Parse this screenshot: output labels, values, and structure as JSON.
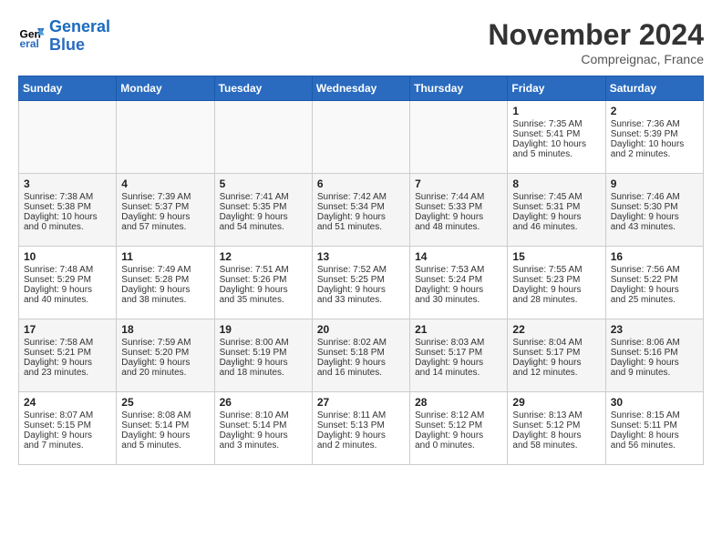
{
  "header": {
    "logo_line1": "General",
    "logo_line2": "Blue",
    "month": "November 2024",
    "location": "Compreignac, France"
  },
  "weekdays": [
    "Sunday",
    "Monday",
    "Tuesday",
    "Wednesday",
    "Thursday",
    "Friday",
    "Saturday"
  ],
  "weeks": [
    [
      {
        "day": "",
        "lines": []
      },
      {
        "day": "",
        "lines": []
      },
      {
        "day": "",
        "lines": []
      },
      {
        "day": "",
        "lines": []
      },
      {
        "day": "",
        "lines": []
      },
      {
        "day": "1",
        "lines": [
          "Sunrise: 7:35 AM",
          "Sunset: 5:41 PM",
          "Daylight: 10 hours",
          "and 5 minutes."
        ]
      },
      {
        "day": "2",
        "lines": [
          "Sunrise: 7:36 AM",
          "Sunset: 5:39 PM",
          "Daylight: 10 hours",
          "and 2 minutes."
        ]
      }
    ],
    [
      {
        "day": "3",
        "lines": [
          "Sunrise: 7:38 AM",
          "Sunset: 5:38 PM",
          "Daylight: 10 hours",
          "and 0 minutes."
        ]
      },
      {
        "day": "4",
        "lines": [
          "Sunrise: 7:39 AM",
          "Sunset: 5:37 PM",
          "Daylight: 9 hours",
          "and 57 minutes."
        ]
      },
      {
        "day": "5",
        "lines": [
          "Sunrise: 7:41 AM",
          "Sunset: 5:35 PM",
          "Daylight: 9 hours",
          "and 54 minutes."
        ]
      },
      {
        "day": "6",
        "lines": [
          "Sunrise: 7:42 AM",
          "Sunset: 5:34 PM",
          "Daylight: 9 hours",
          "and 51 minutes."
        ]
      },
      {
        "day": "7",
        "lines": [
          "Sunrise: 7:44 AM",
          "Sunset: 5:33 PM",
          "Daylight: 9 hours",
          "and 48 minutes."
        ]
      },
      {
        "day": "8",
        "lines": [
          "Sunrise: 7:45 AM",
          "Sunset: 5:31 PM",
          "Daylight: 9 hours",
          "and 46 minutes."
        ]
      },
      {
        "day": "9",
        "lines": [
          "Sunrise: 7:46 AM",
          "Sunset: 5:30 PM",
          "Daylight: 9 hours",
          "and 43 minutes."
        ]
      }
    ],
    [
      {
        "day": "10",
        "lines": [
          "Sunrise: 7:48 AM",
          "Sunset: 5:29 PM",
          "Daylight: 9 hours",
          "and 40 minutes."
        ]
      },
      {
        "day": "11",
        "lines": [
          "Sunrise: 7:49 AM",
          "Sunset: 5:28 PM",
          "Daylight: 9 hours",
          "and 38 minutes."
        ]
      },
      {
        "day": "12",
        "lines": [
          "Sunrise: 7:51 AM",
          "Sunset: 5:26 PM",
          "Daylight: 9 hours",
          "and 35 minutes."
        ]
      },
      {
        "day": "13",
        "lines": [
          "Sunrise: 7:52 AM",
          "Sunset: 5:25 PM",
          "Daylight: 9 hours",
          "and 33 minutes."
        ]
      },
      {
        "day": "14",
        "lines": [
          "Sunrise: 7:53 AM",
          "Sunset: 5:24 PM",
          "Daylight: 9 hours",
          "and 30 minutes."
        ]
      },
      {
        "day": "15",
        "lines": [
          "Sunrise: 7:55 AM",
          "Sunset: 5:23 PM",
          "Daylight: 9 hours",
          "and 28 minutes."
        ]
      },
      {
        "day": "16",
        "lines": [
          "Sunrise: 7:56 AM",
          "Sunset: 5:22 PM",
          "Daylight: 9 hours",
          "and 25 minutes."
        ]
      }
    ],
    [
      {
        "day": "17",
        "lines": [
          "Sunrise: 7:58 AM",
          "Sunset: 5:21 PM",
          "Daylight: 9 hours",
          "and 23 minutes."
        ]
      },
      {
        "day": "18",
        "lines": [
          "Sunrise: 7:59 AM",
          "Sunset: 5:20 PM",
          "Daylight: 9 hours",
          "and 20 minutes."
        ]
      },
      {
        "day": "19",
        "lines": [
          "Sunrise: 8:00 AM",
          "Sunset: 5:19 PM",
          "Daylight: 9 hours",
          "and 18 minutes."
        ]
      },
      {
        "day": "20",
        "lines": [
          "Sunrise: 8:02 AM",
          "Sunset: 5:18 PM",
          "Daylight: 9 hours",
          "and 16 minutes."
        ]
      },
      {
        "day": "21",
        "lines": [
          "Sunrise: 8:03 AM",
          "Sunset: 5:17 PM",
          "Daylight: 9 hours",
          "and 14 minutes."
        ]
      },
      {
        "day": "22",
        "lines": [
          "Sunrise: 8:04 AM",
          "Sunset: 5:17 PM",
          "Daylight: 9 hours",
          "and 12 minutes."
        ]
      },
      {
        "day": "23",
        "lines": [
          "Sunrise: 8:06 AM",
          "Sunset: 5:16 PM",
          "Daylight: 9 hours",
          "and 9 minutes."
        ]
      }
    ],
    [
      {
        "day": "24",
        "lines": [
          "Sunrise: 8:07 AM",
          "Sunset: 5:15 PM",
          "Daylight: 9 hours",
          "and 7 minutes."
        ]
      },
      {
        "day": "25",
        "lines": [
          "Sunrise: 8:08 AM",
          "Sunset: 5:14 PM",
          "Daylight: 9 hours",
          "and 5 minutes."
        ]
      },
      {
        "day": "26",
        "lines": [
          "Sunrise: 8:10 AM",
          "Sunset: 5:14 PM",
          "Daylight: 9 hours",
          "and 3 minutes."
        ]
      },
      {
        "day": "27",
        "lines": [
          "Sunrise: 8:11 AM",
          "Sunset: 5:13 PM",
          "Daylight: 9 hours",
          "and 2 minutes."
        ]
      },
      {
        "day": "28",
        "lines": [
          "Sunrise: 8:12 AM",
          "Sunset: 5:12 PM",
          "Daylight: 9 hours",
          "and 0 minutes."
        ]
      },
      {
        "day": "29",
        "lines": [
          "Sunrise: 8:13 AM",
          "Sunset: 5:12 PM",
          "Daylight: 8 hours",
          "and 58 minutes."
        ]
      },
      {
        "day": "30",
        "lines": [
          "Sunrise: 8:15 AM",
          "Sunset: 5:11 PM",
          "Daylight: 8 hours",
          "and 56 minutes."
        ]
      }
    ]
  ]
}
